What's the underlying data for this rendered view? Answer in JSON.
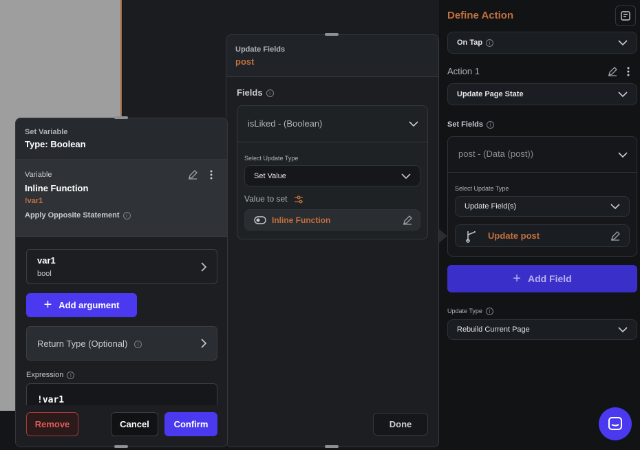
{
  "right_panel": {
    "title": "Define Action",
    "trigger": "On Tap",
    "action_label": "Action 1",
    "action_type": "Update Page State",
    "set_fields_label": "Set Fields",
    "field_name": "post - (Data (post))",
    "select_update_type_label": "Select Update Type",
    "update_type_value": "Update Field(s)",
    "update_target": "Update post",
    "add_field_label": "Add Field",
    "rebuild_label": "Update Type",
    "rebuild_value": "Rebuild Current Page",
    "accent_color": "#3b2fc9"
  },
  "middle_panel": {
    "header_label": "Update Fields",
    "header_value": "post",
    "fields_label": "Fields",
    "field_name": "isLiked - (Boolean)",
    "select_update_type_label": "Select Update Type",
    "update_type_value": "Set Value",
    "value_to_set_label": "Value to set",
    "value": "Inline Function",
    "done_label": "Done"
  },
  "left_panel": {
    "header_label": "Set Variable",
    "header_type": "Type: Boolean",
    "variable_label": "Variable",
    "variable_name": "Inline Function",
    "variable_code": "!var1",
    "apply_opposite_label": "Apply Opposite Statement",
    "arg_name": "var1",
    "arg_type": "bool",
    "add_argument_label": "Add argument",
    "return_type_label": "Return Type (Optional)",
    "expression_label": "Expression",
    "expression_value": "!var1",
    "remove_label": "Remove",
    "cancel_label": "Cancel",
    "confirm_label": "Confirm",
    "brand_color": "#4b39ef"
  },
  "chat_icon": "chat-bubble-icon"
}
